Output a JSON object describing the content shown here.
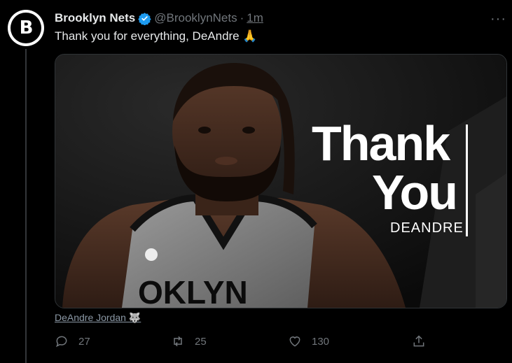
{
  "tweet": {
    "display_name": "Brooklyn Nets",
    "handle": "@BrooklynNets",
    "separator": "·",
    "time": "1m",
    "text": "Thank you for everything, DeAndre 🙏",
    "more_label": "···",
    "avatar_letter": "B"
  },
  "media": {
    "line1": "Thank",
    "line2": "You",
    "name": "DEANDRE",
    "jersey": "OKLYN"
  },
  "tag": {
    "label": "DeAndre Jordan 🐺"
  },
  "actions": {
    "replies": "27",
    "retweets": "25",
    "likes": "130"
  },
  "colors": {
    "background": "#000000",
    "verified": "#1d9bf0",
    "muted": "#71767b",
    "text": "#e7e9ea"
  }
}
